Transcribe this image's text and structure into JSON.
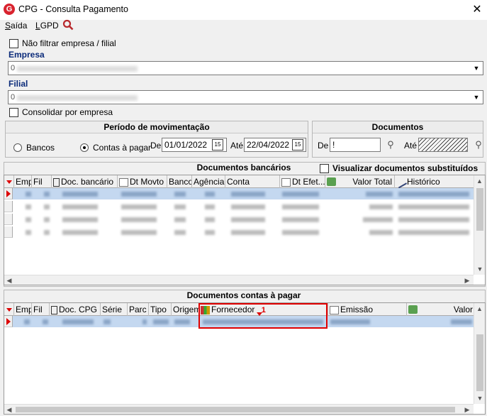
{
  "window": {
    "title": "CPG - Consulta Pagamento",
    "icon_letter": "G"
  },
  "menu": {
    "exit": "Saída",
    "exit_key": "S",
    "exit_rest": "aída",
    "lgpd": "LGPD",
    "lgpd_key": "L",
    "lgpd_rest": "GPD"
  },
  "filters": {
    "no_filter_label": "Não filtrar empresa / filial",
    "empresa_label": "Empresa",
    "empresa_value": "0",
    "filial_label": "Filial",
    "filial_value": "0",
    "consolidar_label": "Consolidar por empresa"
  },
  "periodo": {
    "title": "Período de movimentação",
    "radio_bancos": "Bancos",
    "radio_contas": "Contas à pagar",
    "selected": "Contas à pagar",
    "de_label": "De",
    "de_value": "01/01/2022",
    "ate_label": "Até",
    "ate_value": "22/04/2022"
  },
  "documentos": {
    "title": "Documentos",
    "de_label": "De",
    "de_value": "!",
    "ate_label": "Até"
  },
  "bank_docs": {
    "title": "Documentos bancários",
    "show_substituted_label": "Visualizar documentos substituídos",
    "columns": [
      "Emp",
      "Fil",
      "Doc. bancário",
      "Dt Movto",
      "Banco",
      "Agência",
      "Conta",
      "Dt Efet...",
      "Valor Total",
      "Histórico"
    ],
    "row_count": 4
  },
  "payable_docs": {
    "title": "Documentos contas à pagar",
    "columns": [
      "Emp",
      "Fil",
      "Doc. CPG",
      "Série",
      "Parc",
      "Tipo",
      "Origem",
      "Fornecedor",
      "Emissão",
      "Valor"
    ],
    "sort_indicator": "1",
    "row_count": 1
  },
  "colors": {
    "selection": "#c4d8f0",
    "highlight_box": "#e00000",
    "label_blue": "#0b2b7a"
  }
}
